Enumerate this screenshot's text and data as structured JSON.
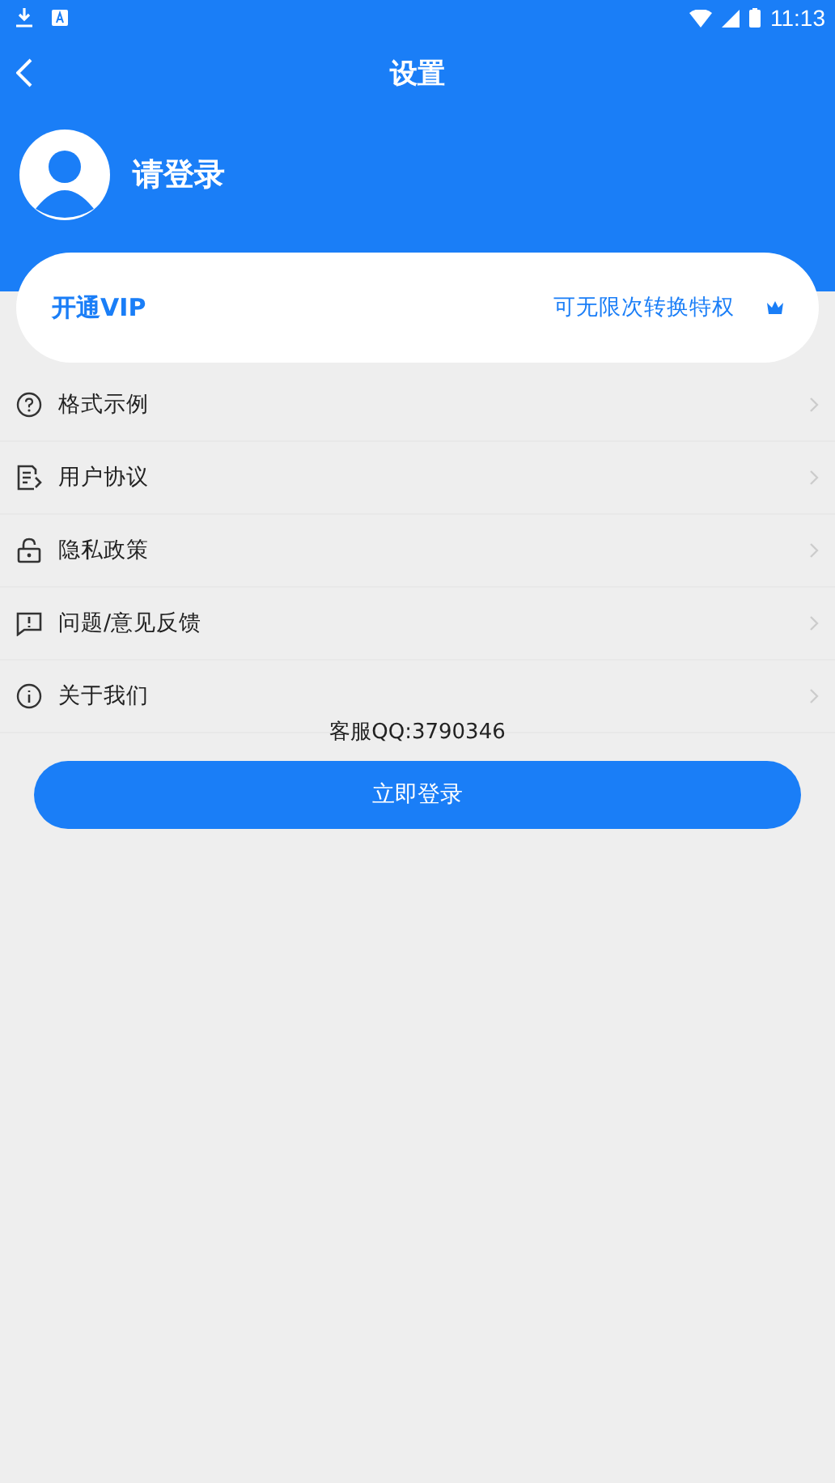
{
  "status_bar": {
    "time": "11:13"
  },
  "header": {
    "title": "设置"
  },
  "profile": {
    "name": "请登录"
  },
  "vip_card": {
    "title": "开通VIP",
    "subtitle": "可无限次转换特权"
  },
  "menu": [
    {
      "kind": "help",
      "label": "格式示例"
    },
    {
      "kind": "document",
      "label": "用户协议"
    },
    {
      "kind": "lock",
      "label": "隐私政策"
    },
    {
      "kind": "feedback",
      "label": "问题/意见反馈"
    },
    {
      "kind": "info",
      "label": "关于我们"
    }
  ],
  "support": "客服QQ:3790346",
  "login_button": "立即登录"
}
